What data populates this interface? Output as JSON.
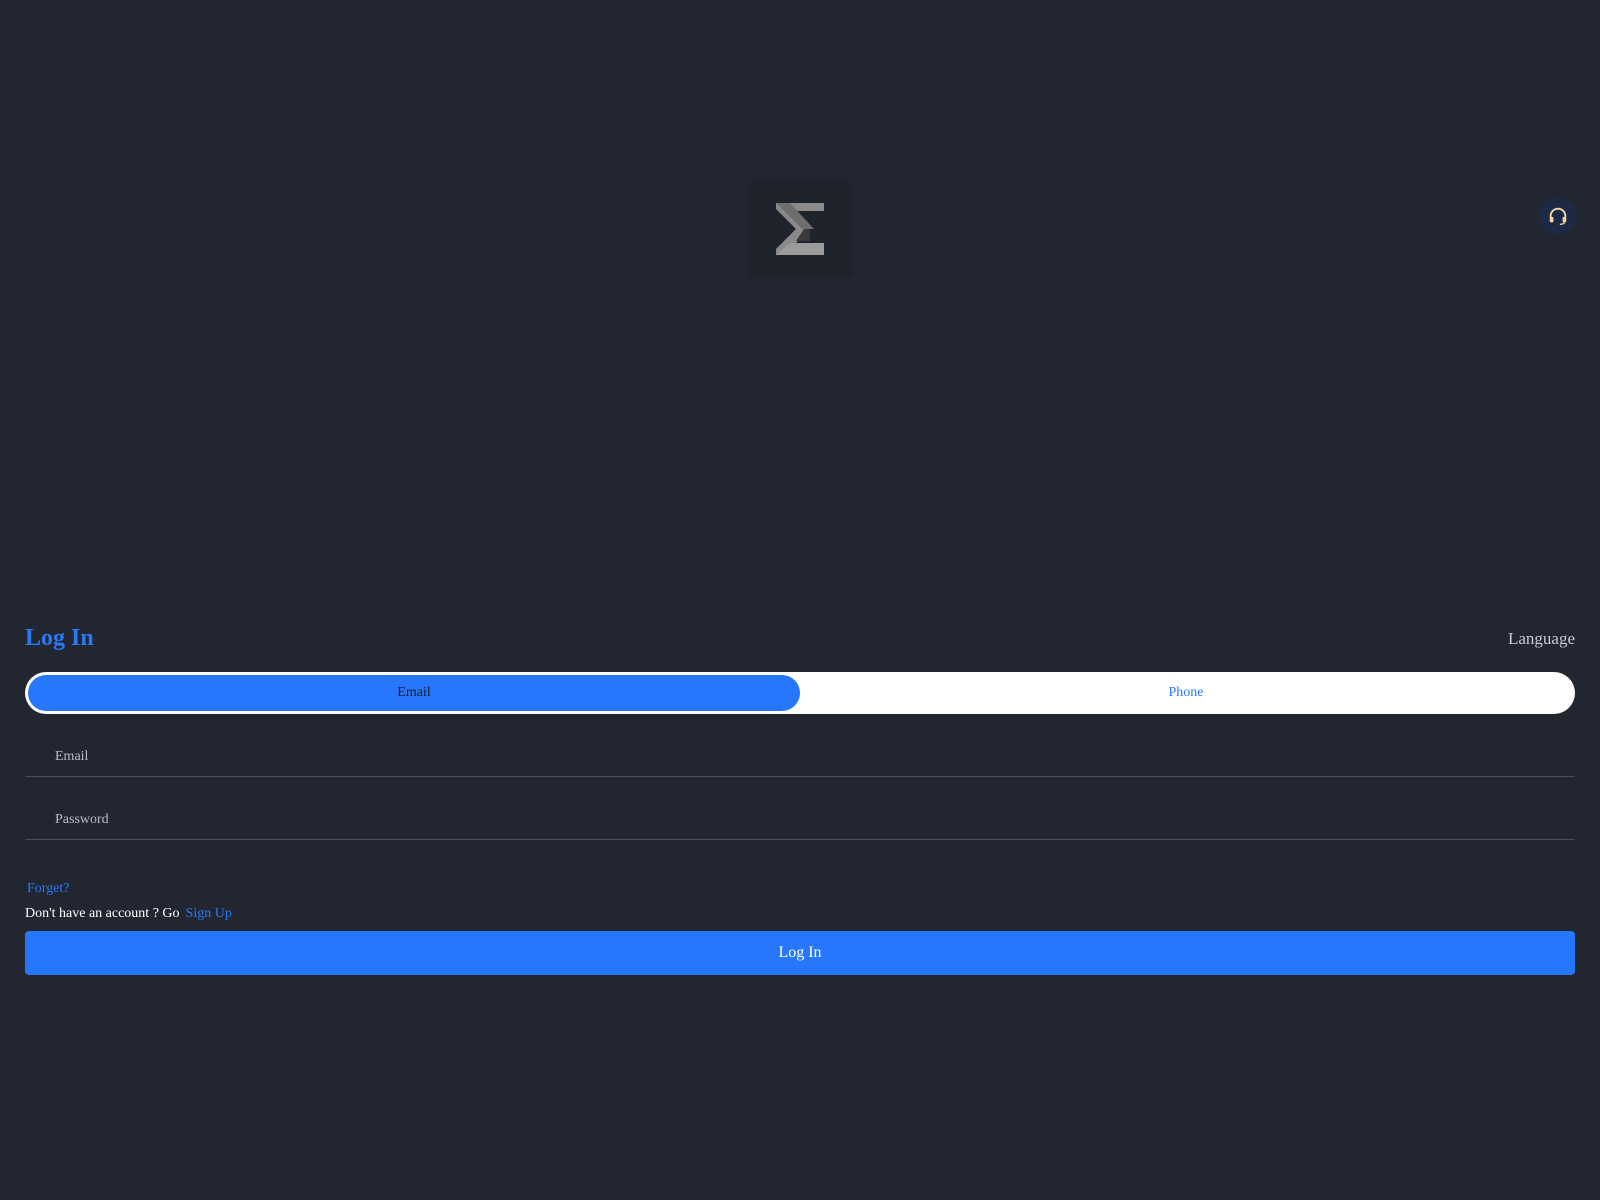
{
  "header": {
    "logo_icon": "sigma-logo-icon",
    "support_icon": "headset-icon"
  },
  "form": {
    "title": "Log In",
    "language_label": "Language",
    "tabs": [
      {
        "label": "Email",
        "active": true
      },
      {
        "label": "Phone",
        "active": false
      }
    ],
    "email": {
      "value": "",
      "placeholder": "Email"
    },
    "password": {
      "value": "",
      "placeholder": "Password"
    },
    "forget_label": "Forget?",
    "signup_prompt": "Don't have an account ? Go",
    "signup_label": "Sign Up",
    "submit_label": "Log In"
  },
  "colors": {
    "background": "#222630",
    "accent": "#2677fc",
    "link": "#2b78f5",
    "support_bg": "#1c2a45",
    "headset": "#f3d6a4"
  }
}
